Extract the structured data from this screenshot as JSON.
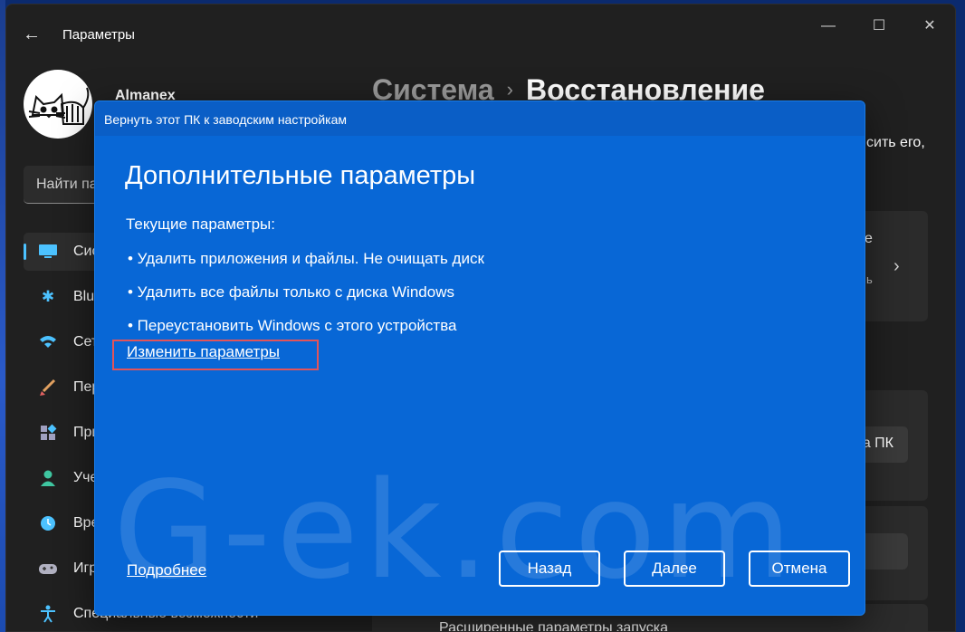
{
  "settings": {
    "title": "Параметры",
    "user_name": "Almanex",
    "search_placeholder": "Найти па",
    "nav": [
      {
        "label": "Сис",
        "icon": "system-icon"
      },
      {
        "label": "Blu",
        "icon": "bluetooth-icon"
      },
      {
        "label": "Сет",
        "icon": "network-icon"
      },
      {
        "label": "Пер",
        "icon": "personalization-icon"
      },
      {
        "label": "При",
        "icon": "apps-icon"
      },
      {
        "label": "Уче",
        "icon": "accounts-icon"
      },
      {
        "label": "Вре",
        "icon": "time-icon"
      },
      {
        "label": "Игр",
        "icon": "gaming-icon"
      },
      {
        "label": "Специальные возможности",
        "icon": "accessibility-icon"
      }
    ],
    "breadcrumb": {
      "parent": "Система",
      "separator": "›",
      "current": "Восстановление"
    },
    "right_partial": {
      "line1": "сить его,",
      "card1_title": "е",
      "card1_sub": "ь",
      "reset_button": "а ПК",
      "advanced_startup": "Расширенные параметры запуска"
    }
  },
  "dialog": {
    "title": "Вернуть этот ПК к заводским настройкам",
    "heading": "Дополнительные параметры",
    "current_label": "Текущие параметры:",
    "options": [
      "•  Удалить приложения и файлы. Не очищать диск",
      "•  Удалить все файлы только с диска Windows",
      "• Переустановить Windows с этого устройства"
    ],
    "change_link": "Изменить параметры",
    "more_link": "Подробнее",
    "buttons": {
      "back": "Назад",
      "next": "Далее",
      "cancel": "Отмена"
    },
    "watermark": "G-ek.com"
  },
  "colors": {
    "dialog_bg": "#0867d6",
    "window_bg": "#202020",
    "accent": "#4cc2ff",
    "highlight_box": "#e2545a"
  }
}
